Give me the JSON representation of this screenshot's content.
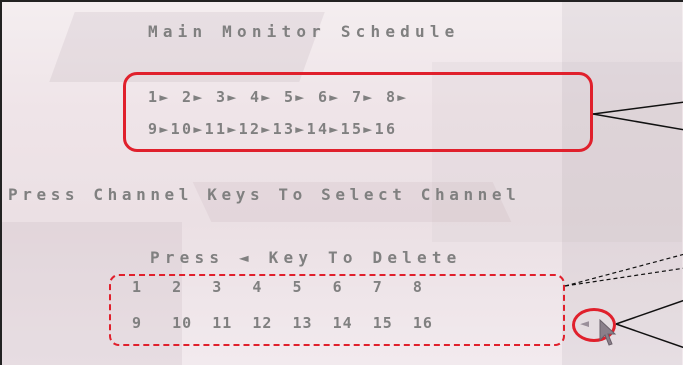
{
  "title": "Main Monitor Schedule",
  "sequence": {
    "row1": "1► 2► 3► 4► 5► 6► 7► 8►",
    "row2": "9►10►11►12►13►14►15►16"
  },
  "instruction_select": "Press Channel Keys To Select Channel",
  "instruction_delete": "Press ◄ Key To Delete",
  "delete_list": {
    "row1": "1   2   3   4   5   6   7   8",
    "row2": "9   10  11  12  13  14  15  16"
  },
  "delete_arrow_glyph": "◄",
  "colors": {
    "osd_text": "#808080",
    "highlight": "#e0202c"
  }
}
